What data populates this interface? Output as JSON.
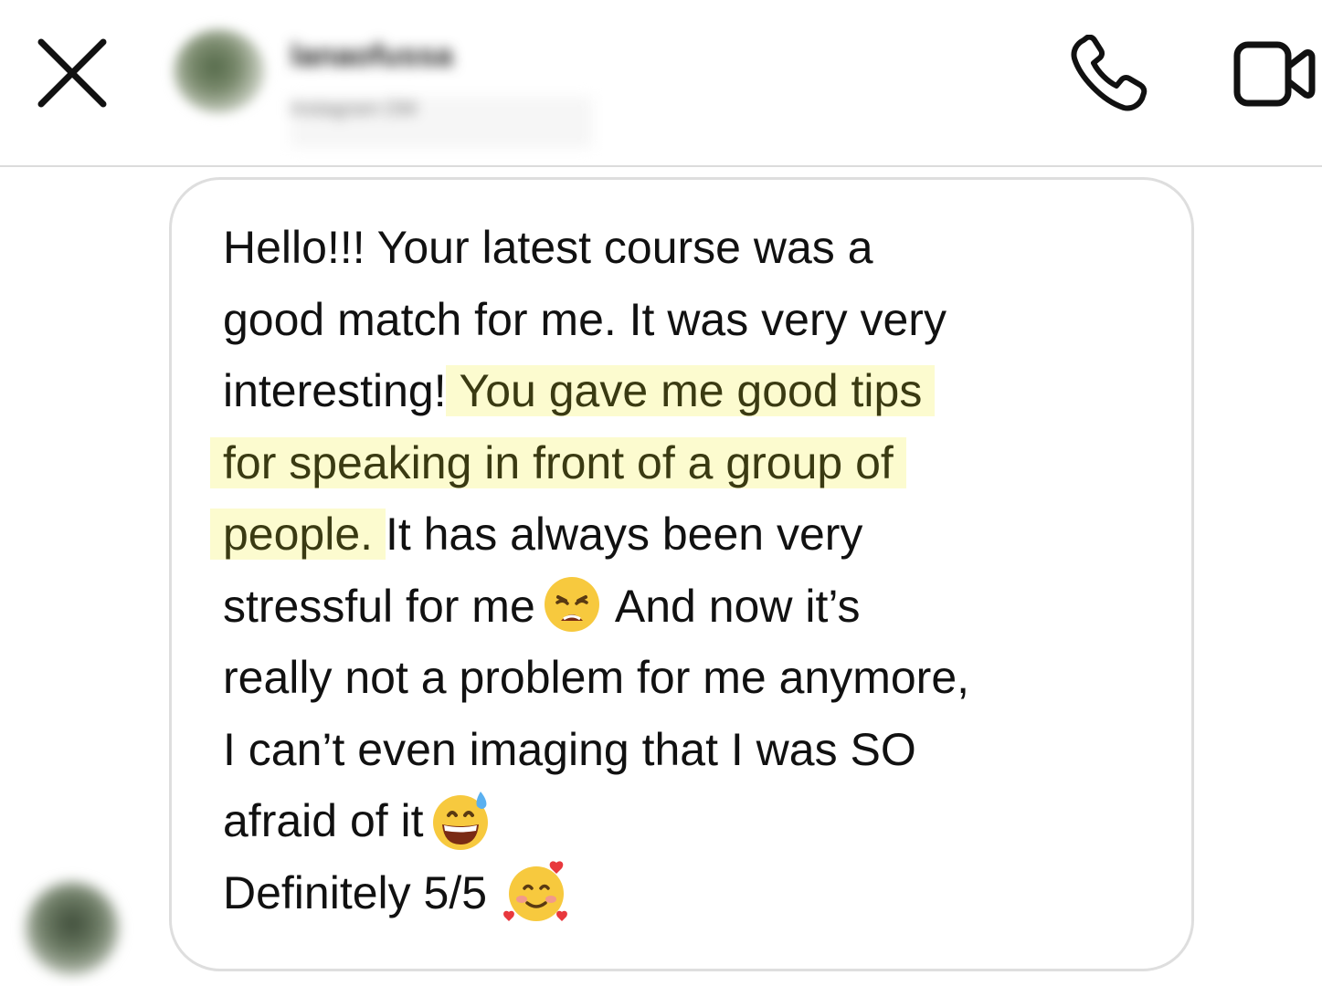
{
  "header": {
    "contact_name": "lanaofussa",
    "contact_status": "Instagram DM"
  },
  "message": {
    "line1": "Hello!!! Your latest course was a",
    "line2": "good match for me. It was very very",
    "line3_plain": "interesting! ",
    "line3_highlight": "You gave me good tips",
    "line4_highlight": "for speaking in front of a group of",
    "line5_highlight": "people.",
    "line5_plain": " It has always been very",
    "line6_a": "stressful for me",
    "line6_b": " And now it’s",
    "line7": "really not a problem for me anymore,",
    "line8": "I can’t even imaging that I was SO",
    "line9": "afraid of it",
    "line10": "Definitely 5/5 "
  },
  "colors": {
    "highlight": "#fcfbcf",
    "bubble_border": "#dedede",
    "divider": "#dbdbdb",
    "text": "#111111"
  },
  "icons": {
    "close": "close-icon",
    "call": "phone-icon",
    "video": "video-camera-icon",
    "emoji_1": "weary-face-emoji",
    "emoji_2": "grinning-sweat-emoji",
    "emoji_3": "smiling-face-with-hearts-emoji"
  }
}
